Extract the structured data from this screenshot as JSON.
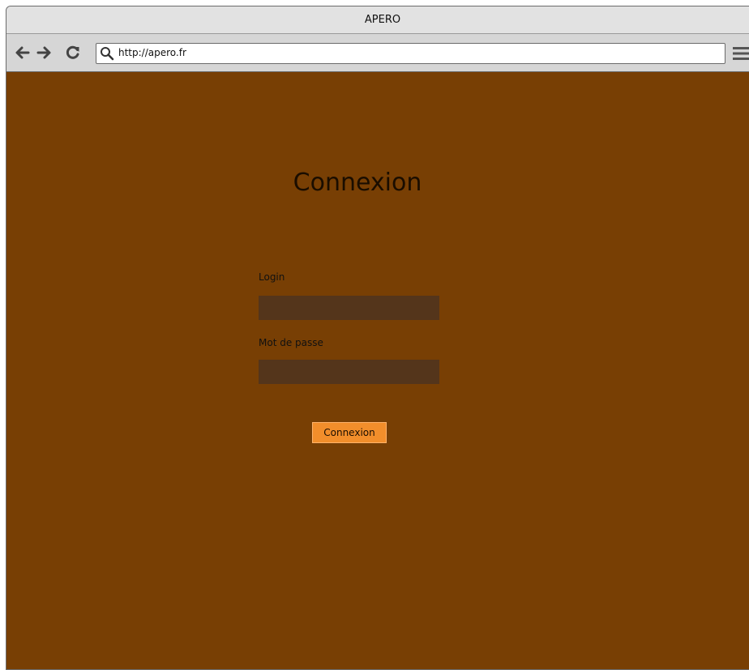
{
  "window": {
    "title": "APERO"
  },
  "toolbar": {
    "back_icon": "arrow-left-icon",
    "forward_icon": "arrow-right-icon",
    "reload_icon": "reload-icon",
    "url": "http://apero.fr",
    "menu_icon": "hamburger-menu-icon"
  },
  "page": {
    "title": "Connexion",
    "login_label": "Login",
    "login_value": "",
    "password_label": "Mot de passe",
    "password_value": "",
    "submit_label": "Connexion"
  },
  "colors": {
    "page_background": "#783f04",
    "field_background": "#54351b",
    "button_background": "#f28e2b"
  }
}
